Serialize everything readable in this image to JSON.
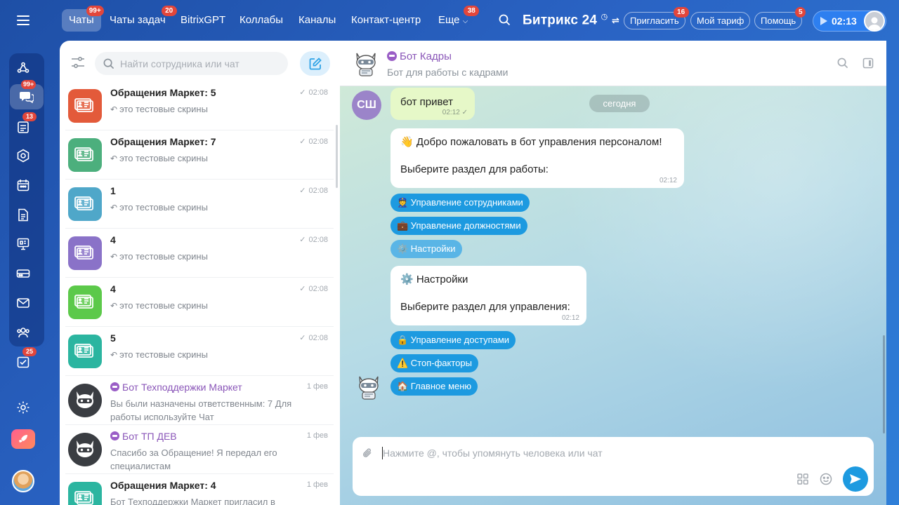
{
  "topbar": {
    "nav": [
      {
        "label": "Чаты",
        "badge": "99+"
      },
      {
        "label": "Чаты задач",
        "badge": "20"
      },
      {
        "label": "BitrixGPT",
        "badge": ""
      },
      {
        "label": "Коллабы",
        "badge": ""
      },
      {
        "label": "Каналы",
        "badge": ""
      },
      {
        "label": "Контакт-центр",
        "badge": ""
      },
      {
        "label": "Еще",
        "badge": "38"
      }
    ],
    "brand": "Битрикс 24",
    "invite": {
      "label": "Пригласить",
      "badge": "16"
    },
    "tariff": {
      "label": "Мой тариф"
    },
    "help": {
      "label": "Помощь",
      "badge": "5"
    },
    "timer": "02:13"
  },
  "rail": {
    "chats_badge": "99+",
    "tasks_badge": "13",
    "checklist_badge": "25"
  },
  "list": {
    "search_placeholder": "Найти сотрудника или чат",
    "items": [
      {
        "title": "Обращения Маркет: 5",
        "sub": "это тестовые скрины",
        "time": "02:08",
        "color": "#e35a3a",
        "type": "contact",
        "bot": false,
        "reply": true
      },
      {
        "title": "Обращения Маркет: 7",
        "sub": "это тестовые скрины",
        "time": "02:08",
        "color": "#4caf7d",
        "type": "contact",
        "bot": false,
        "reply": true
      },
      {
        "title": "1",
        "sub": "это тестовые скрины",
        "time": "02:08",
        "color": "#4fa7c9",
        "type": "contact",
        "bot": false,
        "reply": true
      },
      {
        "title": "4",
        "sub": "это тестовые скрины",
        "time": "02:08",
        "color": "#8a72c8",
        "type": "contact",
        "bot": false,
        "reply": true
      },
      {
        "title": "4",
        "sub": "это тестовые скрины",
        "time": "02:08",
        "color": "#5cc94a",
        "type": "contact",
        "bot": false,
        "reply": true
      },
      {
        "title": "5",
        "sub": "это тестовые скрины",
        "time": "02:08",
        "color": "#2bb5a0",
        "type": "contact",
        "bot": false,
        "reply": true
      },
      {
        "title": "Бот Техподдержки Маркет",
        "sub": "Вы были назначены ответственным: 7 Для работы используйте Чат",
        "time": "1 фев",
        "color": "#3a3d42",
        "type": "bot",
        "bot": true,
        "reply": false
      },
      {
        "title": "Бот ТП ДЕВ",
        "sub": "Спасибо за Обращение! Я передал его специалистам",
        "time": "1 фев",
        "color": "#3a3d42",
        "type": "bot",
        "bot": true,
        "reply": false
      },
      {
        "title": "Обращения Маркет: 4",
        "sub": "Бот Техподдержки Маркет пригласил в",
        "time": "1 фев",
        "color": "#2bb5a0",
        "type": "contact",
        "bot": false,
        "reply": false
      }
    ]
  },
  "chat": {
    "title": "Бот Кадры",
    "subtitle": "Бот для работы с кадрами",
    "user_initials": "СШ",
    "user_message": {
      "text": "бот привет",
      "time": "02:12"
    },
    "date_chip": "сегодня",
    "welcome": {
      "line1": "👋 Добро пожаловать в бот управления персоналом!",
      "line2": "Выберите раздел для работы:",
      "time": "02:12"
    },
    "buttons1": [
      "👮 Управление сотрудниками",
      "💼 Управление должностями",
      "⚙️ Настройки"
    ],
    "settings": {
      "line1": "⚙️ Настройки",
      "line2": "Выберите раздел для управления:",
      "time": "02:12"
    },
    "buttons2": [
      "🔒 Управление доступами",
      "⚠️ Стоп-факторы",
      "🏠 Главное меню"
    ]
  },
  "composer": {
    "placeholder": "Нажмите @, чтобы упомянуть человека или чат"
  }
}
